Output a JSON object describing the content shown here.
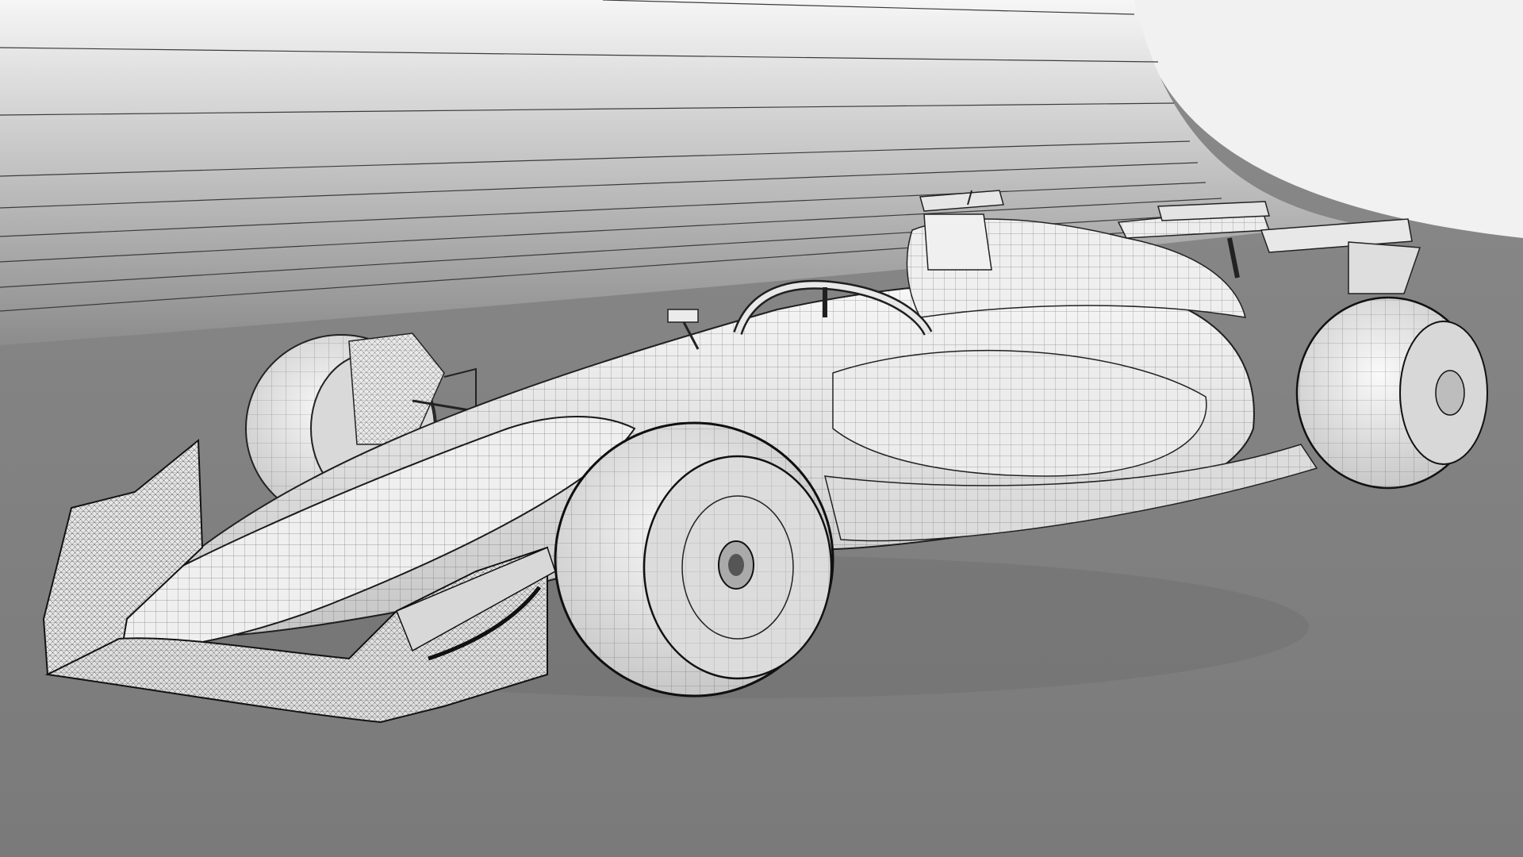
{
  "scene": {
    "subject": "f1-car-wireframe-render",
    "colors": {
      "floor": "#7d7d7d",
      "backdrop_light": "#f2f2f2",
      "backdrop_dark": "#8a8a8a",
      "surface": "#efefef",
      "surface_shadow": "#bdbdbd",
      "wire": "#2a2a2a"
    }
  }
}
